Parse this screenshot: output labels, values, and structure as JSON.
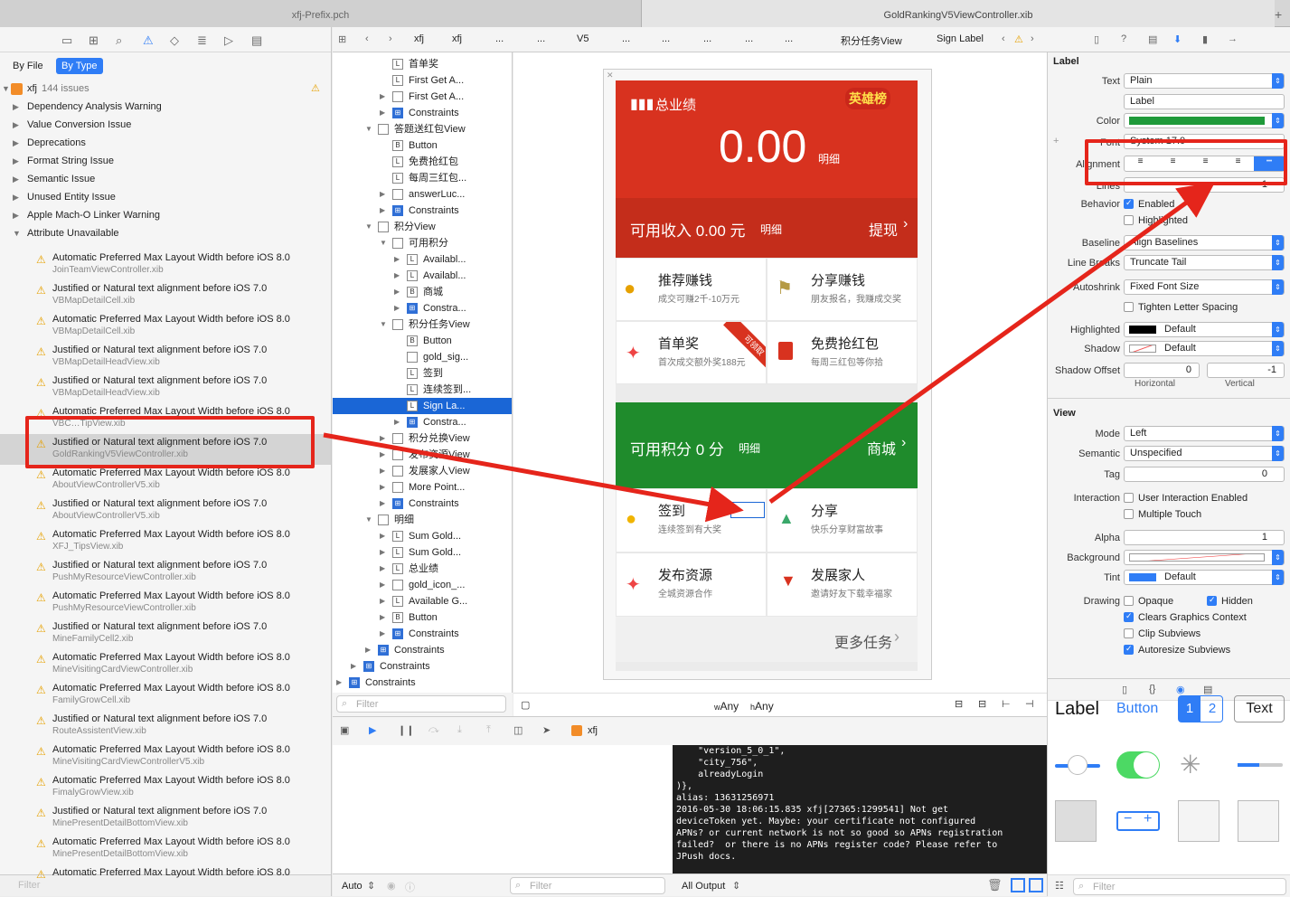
{
  "tabs": [
    "xfj-Prefix.pch",
    "GoldRankingV5ViewController.xib"
  ],
  "navigator": {
    "scope_buttons": [
      "By File",
      "By Type"
    ],
    "project": "xfj",
    "issue_count": "144 issues",
    "categories": [
      "Dependency Analysis Warning",
      "Value Conversion Issue",
      "Deprecations",
      "Format String Issue",
      "Semantic Issue",
      "Unused Entity Issue",
      "Apple Mach-O Linker Warning",
      "Attribute Unavailable"
    ],
    "warnings": [
      {
        "title": "Automatic Preferred Max Layout Width before iOS 8.0",
        "file": "JoinTeamViewController.xib"
      },
      {
        "title": "Justified or Natural text alignment before iOS 7.0",
        "file": "VBMapDetailCell.xib"
      },
      {
        "title": "Automatic Preferred Max Layout Width before iOS 8.0",
        "file": "VBMapDetailCell.xib"
      },
      {
        "title": "Justified or Natural text alignment before iOS 7.0",
        "file": "VBMapDetailHeadView.xib"
      },
      {
        "title": "Justified or Natural text alignment before iOS 7.0",
        "file": "VBMapDetailHeadView.xib"
      },
      {
        "title": "Automatic Preferred Max Layout Width before iOS 8.0",
        "file": "VBC…TipView.xib"
      },
      {
        "title": "Justified or Natural text alignment before iOS 7.0",
        "file": "GoldRankingV5ViewController.xib"
      },
      {
        "title": "Automatic Preferred Max Layout Width before iOS 8.0",
        "file": "AboutViewControllerV5.xib"
      },
      {
        "title": "Justified or Natural text alignment before iOS 7.0",
        "file": "AboutViewControllerV5.xib"
      },
      {
        "title": "Automatic Preferred Max Layout Width before iOS 8.0",
        "file": "XFJ_TipsView.xib"
      },
      {
        "title": "Justified or Natural text alignment before iOS 7.0",
        "file": "PushMyResourceViewController.xib"
      },
      {
        "title": "Automatic Preferred Max Layout Width before iOS 8.0",
        "file": "PushMyResourceViewController.xib"
      },
      {
        "title": "Justified or Natural text alignment before iOS 7.0",
        "file": "MineFamilyCell2.xib"
      },
      {
        "title": "Automatic Preferred Max Layout Width before iOS 8.0",
        "file": "MineVisitingCardViewController.xib"
      },
      {
        "title": "Automatic Preferred Max Layout Width before iOS 8.0",
        "file": "FamilyGrowCell.xib"
      },
      {
        "title": "Justified or Natural text alignment before iOS 7.0",
        "file": "RouteAssistentView.xib"
      },
      {
        "title": "Automatic Preferred Max Layout Width before iOS 8.0",
        "file": "MineVisitingCardViewControllerV5.xib"
      },
      {
        "title": "Automatic Preferred Max Layout Width before iOS 8.0",
        "file": "FimalyGrowView.xib"
      },
      {
        "title": "Justified or Natural text alignment before iOS 7.0",
        "file": "MinePresentDetailBottomView.xib"
      },
      {
        "title": "Automatic Preferred Max Layout Width before iOS 8.0",
        "file": "MinePresentDetailBottomView.xib"
      },
      {
        "title": "Automatic Preferred Max Layout Width before iOS 8.0",
        "file": ""
      }
    ],
    "filter_placeholder": "Filter"
  },
  "jumpbar": [
    "xfj",
    "xfj",
    "...",
    "...",
    "V5",
    "...",
    "...",
    "...",
    "...",
    "...",
    "积分任务View",
    "Sign Label"
  ],
  "outline": {
    "rows": [
      "首单奖",
      "First Get A...",
      "First Get A...",
      "Constraints",
      "答题送红包View",
      "Button",
      "免费抢红包",
      "每周三红包...",
      "answerLuc...",
      "Constraints",
      "积分View",
      "可用积分",
      "Availabl...",
      "Availabl...",
      "商城",
      "Constra...",
      "积分任务View",
      "Button",
      "gold_sig...",
      "签到",
      "连续签到...",
      "Sign La...",
      "Constra...",
      "积分兑换View",
      "发布资源View",
      "发展家人View",
      "More Point...",
      "Constraints",
      "明细",
      "Sum Gold...",
      "Sum Gold...",
      "总业绩",
      "gold_icon_...",
      "Available G...",
      "Button",
      "Constraints",
      "Constraints",
      "Constraints",
      "Constraints"
    ],
    "filter_placeholder": "Filter"
  },
  "phone": {
    "total_label": "总业绩",
    "badge": "英雄榜",
    "amount": "0.00",
    "detail": "明细",
    "income": "可用收入 0.00 元",
    "income_detail": "明细",
    "withdraw": "提现",
    "recommend_title": "推荐赚钱",
    "recommend_sub": "成交可赚2千-10万元",
    "share_title": "分享赚钱",
    "share_sub": "朋友报名，我赚成交奖",
    "first_title": "首单奖",
    "first_sub": "首次成交额外奖188元",
    "ribbon": "可领取",
    "redpack_title": "免费抢红包",
    "redpack_sub": "每周三红包等你拾",
    "points": "可用积分 0 分",
    "points_detail": "明细",
    "mall": "商城",
    "signin_title": "签到",
    "signin_sub": "连续签到有大奖",
    "share2_title": "分享",
    "share2_sub": "快乐分享财富故事",
    "publish_title": "发布资源",
    "publish_sub": "全城资源合作",
    "family_title": "发展家人",
    "family_sub": "邀请好友下载幸福家",
    "more": "更多任务"
  },
  "size_class": {
    "w": "Any",
    "h": "Any"
  },
  "inspector": {
    "section_label": "Label",
    "text_label": "Text",
    "text_value": "Plain",
    "text_content": "Label",
    "color_label": "Color",
    "font_label": "Font",
    "font_value": "System 17.0",
    "alignment_label": "Alignment",
    "lines_label": "Lines",
    "lines_value": "1",
    "behavior_label": "Behavior",
    "enabled": "Enabled",
    "highlighted": "Highlighted",
    "baseline_label": "Baseline",
    "baseline_value": "Align Baselines",
    "linebreaks_label": "Line Breaks",
    "linebreaks_value": "Truncate Tail",
    "autoshrink_label": "Autoshrink",
    "autoshrink_value": "Fixed Font Size",
    "tighten": "Tighten Letter Spacing",
    "highlighted_label": "Highlighted",
    "highlighted_value": "Default",
    "shadow_label": "Shadow",
    "shadow_value": "Default",
    "shadow_offset_label": "Shadow Offset",
    "shadow_h": "0",
    "shadow_v": "-1",
    "horizontal": "Horizontal",
    "vertical": "Vertical",
    "view_section": "View",
    "mode_label": "Mode",
    "mode_value": "Left",
    "semantic_label": "Semantic",
    "semantic_value": "Unspecified",
    "tag_label": "Tag",
    "tag_value": "0",
    "interaction_label": "Interaction",
    "user_interaction": "User Interaction Enabled",
    "multiple_touch": "Multiple Touch",
    "alpha_label": "Alpha",
    "alpha_value": "1",
    "background_label": "Background",
    "tint_label": "Tint",
    "tint_value": "Default",
    "drawing_label": "Drawing",
    "opaque": "Opaque",
    "hidden": "Hidden",
    "clears": "Clears Graphics Context",
    "clip": "Clip Subviews",
    "autoresize": "Autoresize Subviews"
  },
  "library": {
    "label": "Label",
    "button": "Button",
    "seg1": "1",
    "seg2": "2",
    "text": "Text",
    "filter_placeholder": "Filter"
  },
  "debug": {
    "scheme": "xfj",
    "auto": "Auto",
    "filter_placeholder": "Filter",
    "all_output": "All Output",
    "console": "    \"version_5_0_1\",\n    \"city_756\",\n    alreadyLogin\n)},\nalias: 13631256971\n2016-05-30 18:06:15.835 xfj[27365:1299541] Not get\ndeviceToken yet. Maybe: your certificate not configured\nAPNs? or current network is not so good so APNs registration\nfailed?  or there is no APNs register code? Please refer to\nJPush docs."
  },
  "colors": {
    "accent": "#2f7df6",
    "red": "#d8321f",
    "green": "#1f8b2c",
    "arrow": "#e5251b",
    "label_color": "#1f9a3a"
  }
}
